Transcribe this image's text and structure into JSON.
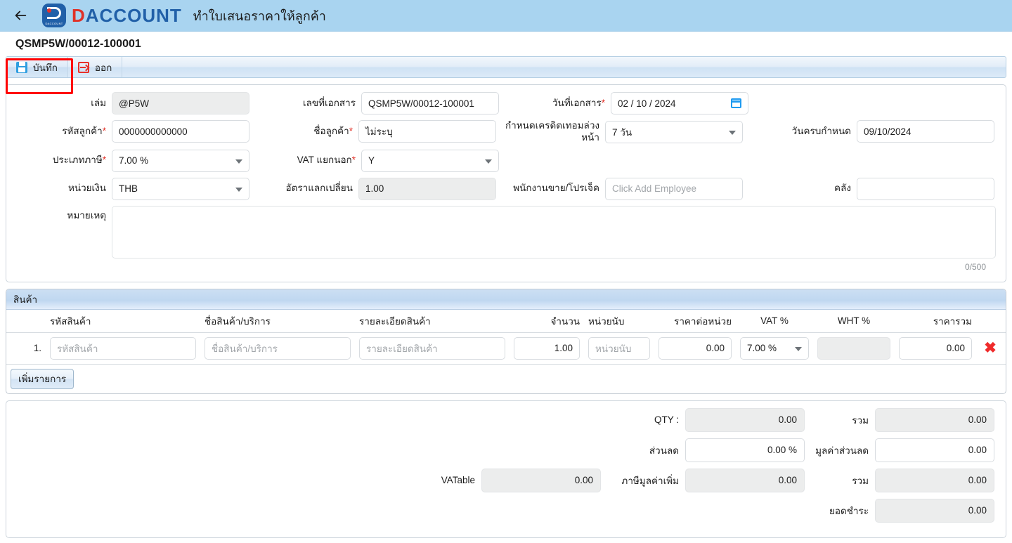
{
  "header": {
    "back_icon": "arrow-left-icon",
    "logo_sub": "DACCOUNT",
    "wordmark_first": "D",
    "wordmark_rest": "ACCOUNT",
    "title": "ทำใบเสนอราคาให้ลูกค้า",
    "bg_color": "#a9d4f0",
    "logo_blue": "#2160a8",
    "logo_red": "#e03127"
  },
  "doc": {
    "number": "QSMP5W/00012-100001"
  },
  "toolbar": {
    "save_label": "บันทึก",
    "exit_label": "ออก"
  },
  "form": {
    "book_label": "เล่ม",
    "book_value": "@P5W",
    "docno_label": "เลขที่เอกสาร",
    "docno_value": "QSMP5W/00012-100001",
    "docdate_label": "วันที่เอกสาร",
    "docdate_req": "*",
    "docdate_value": "02 / 10 /  2024",
    "custcode_label": "รหัสลูกค้า",
    "custcode_req": "*",
    "custcode_value": "0000000000000",
    "custname_label": "ชื่อลูกค้า",
    "custname_req": "*",
    "custname_value": "ไม่ระบุ",
    "credit_label": "กำหนดเครดิตเทอมล่วงหน้า",
    "credit_value": "7 วัน",
    "duedate_label": "วันครบกำหนด",
    "duedate_value": "09/10/2024",
    "taxtype_label": "ประเภทภาษี",
    "taxtype_req": "*",
    "taxtype_value": "7.00 %",
    "vatout_label": "VAT แยกนอก",
    "vatout_req": "*",
    "vatout_value": "Y",
    "currency_label": "หน่วยเงิน",
    "currency_value": "THB",
    "exrate_label": "อัตราแลกเปลี่ยน",
    "exrate_value": "1.00",
    "employee_label": "พนักงานขาย/โปรเจ็ค",
    "employee_placeholder": "Click Add Employee",
    "warehouse_label": "คลัง",
    "warehouse_value": "",
    "note_label": "หมายเหตุ",
    "note_value": "",
    "note_counter": "0/500"
  },
  "items": {
    "section_title": "สินค้า",
    "columns": [
      "รหัสสินค้า",
      "ชื่อสินค้า/บริการ",
      "รายละเอียดสินค้า",
      "จำนวน",
      "หน่วยนับ",
      "ราคาต่อหน่วย",
      "VAT %",
      "WHT %",
      "ราคารวม"
    ],
    "rows": [
      {
        "no": "1.",
        "code_placeholder": "รหัสสินค้า",
        "name_placeholder": "ชื่อสินค้า/บริการ",
        "detail_placeholder": "รายละเอียดสินค้า",
        "qty": "1.00",
        "unit_placeholder": "หน่วยนับ",
        "price": "0.00",
        "vat": "7.00 %",
        "wht": "",
        "amount": "0.00",
        "delete_icon": "close-icon"
      }
    ],
    "add_label": "เพิ่มรายการ"
  },
  "totals": {
    "qty_label": "QTY :",
    "qty_value": "0.00",
    "sum1_label": "รวม",
    "sum1_value": "0.00",
    "discount_label": "ส่วนลด",
    "discount_value": "0.00 %",
    "discount_amt_label": "มูลค่าส่วนลด",
    "discount_amt_value": "0.00",
    "vatable_label": "VATable",
    "vatable_value": "0.00",
    "vat_label": "ภาษีมูลค่าเพิ่ม",
    "vat_value": "0.00",
    "sum2_label": "รวม",
    "sum2_value": "0.00",
    "payment_label": "ยอดชำระ",
    "payment_value": "0.00"
  }
}
